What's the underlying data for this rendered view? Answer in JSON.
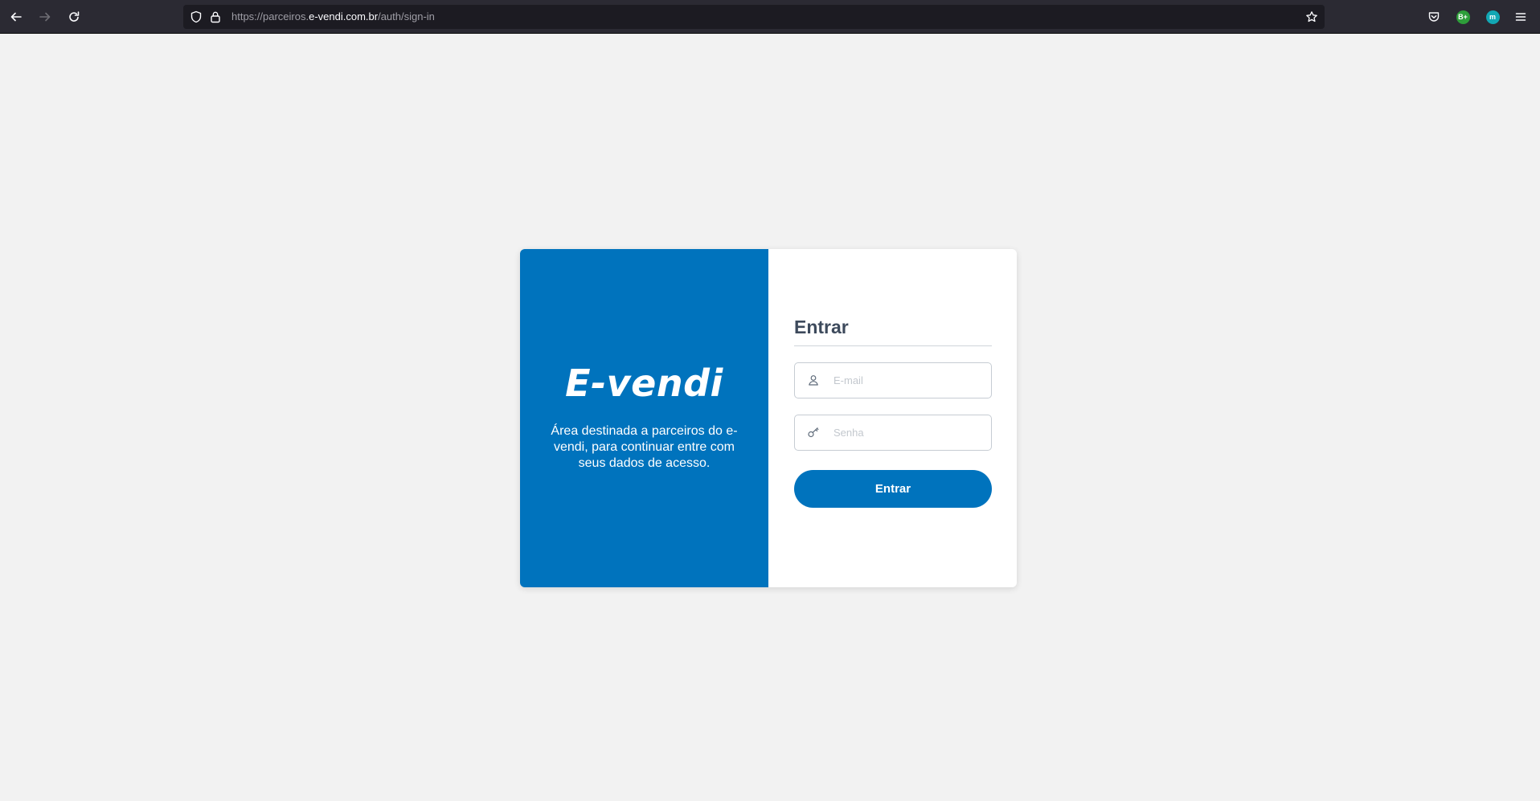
{
  "browser": {
    "url_prefix": "https://parceiros.",
    "url_host": "e-vendi.com.br",
    "url_path": "/auth/sign-in",
    "extensions": [
      {
        "label": "B+",
        "color": "#2e9e3a"
      },
      {
        "label": "m",
        "color": "#12a7b4"
      }
    ]
  },
  "brand": {
    "logo": "E-vendi",
    "tagline": "Área destinada a parceiros do e-vendi, para continuar entre com seus dados de acesso.",
    "primary_color": "#0073bd"
  },
  "login": {
    "title": "Entrar",
    "email_placeholder": "E-mail",
    "password_placeholder": "Senha",
    "submit_label": "Entrar"
  }
}
